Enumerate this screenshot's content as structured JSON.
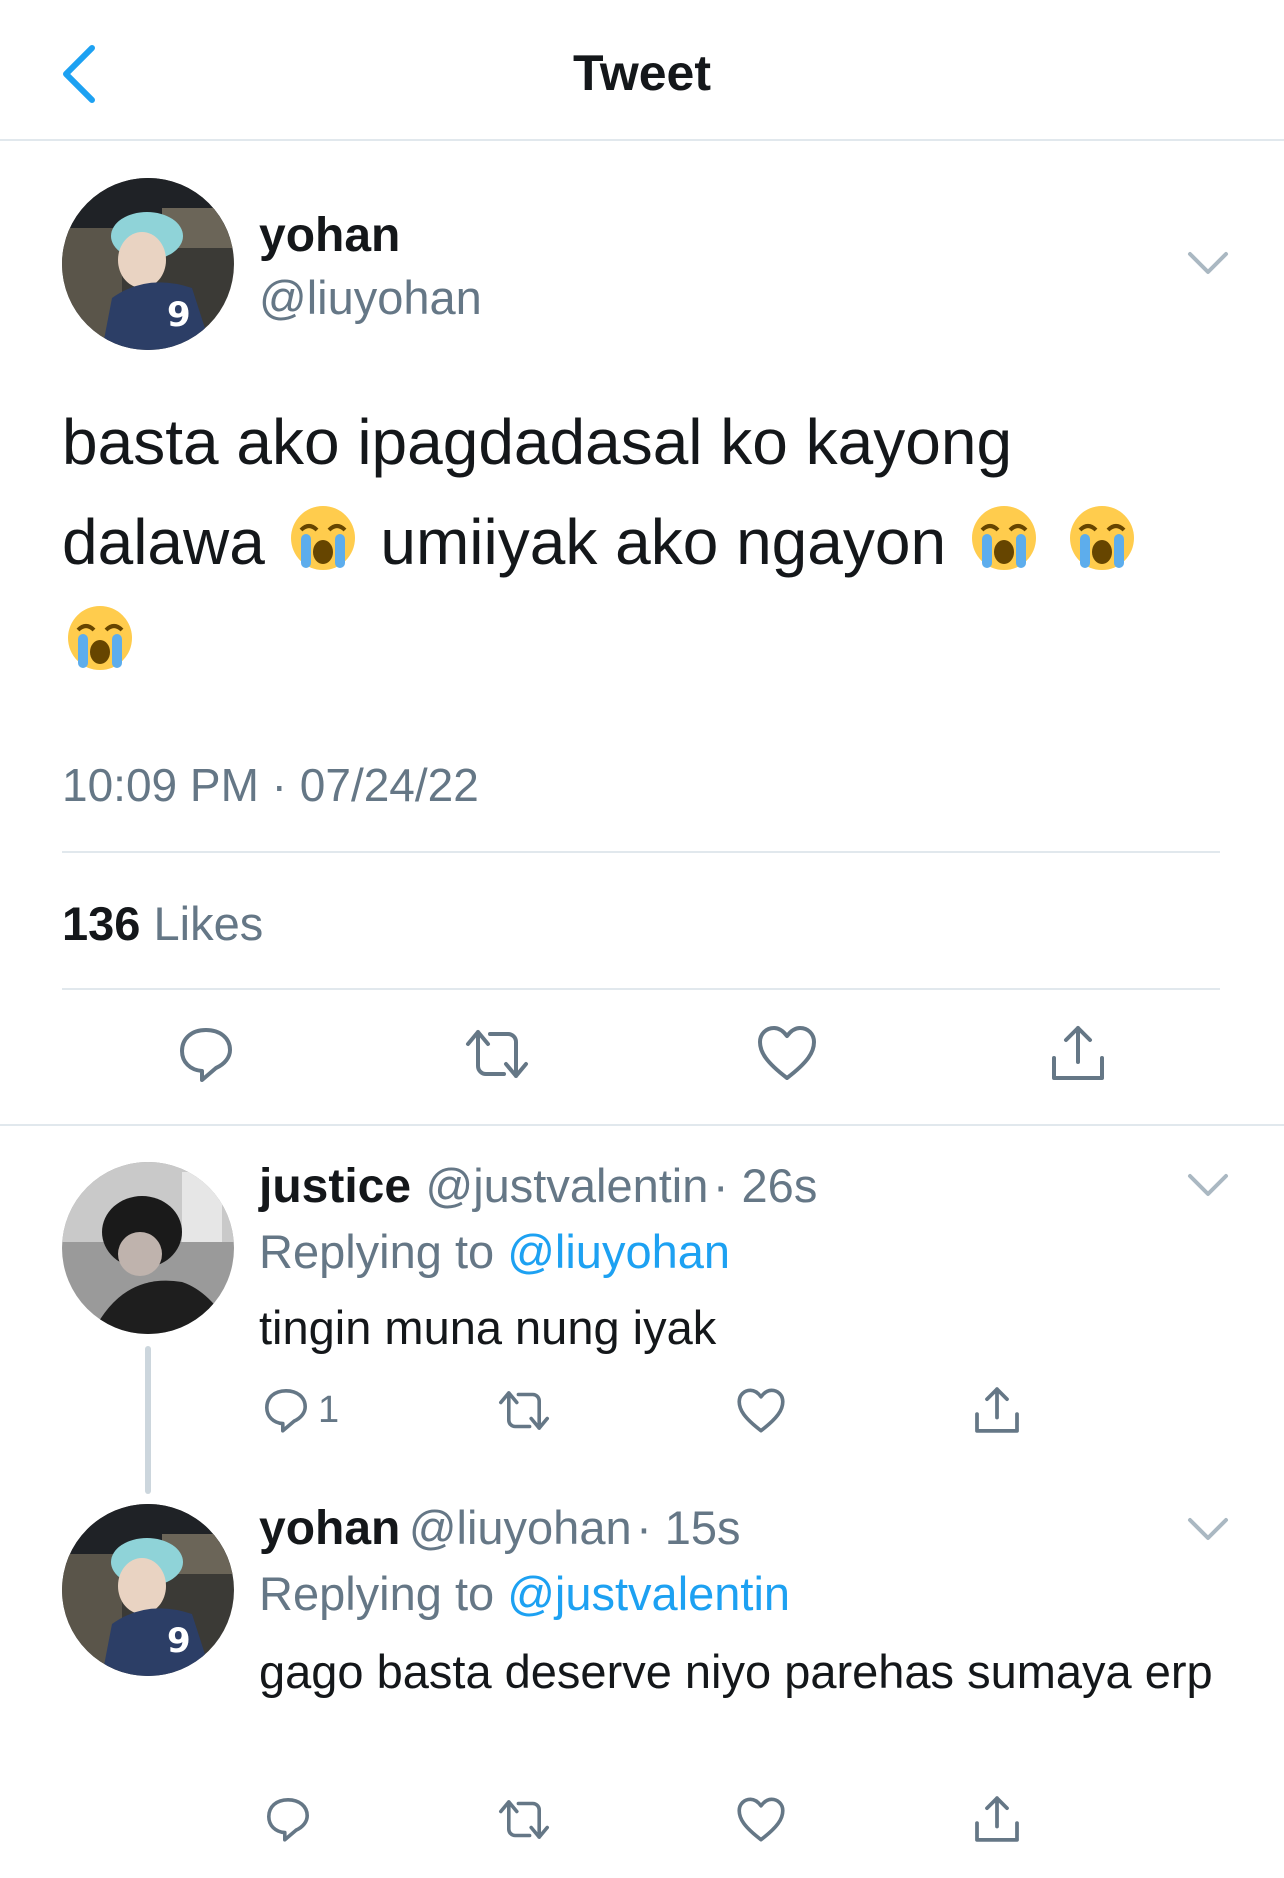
{
  "header": {
    "title": "Tweet"
  },
  "tweet": {
    "name": "yohan",
    "handle": "@liuyohan",
    "text_line1": "basta ako ipagdadasal ko kayong",
    "text_line2a": "dalawa",
    "text_line2b": "umiiyak ako ngayon",
    "emoji": "crying-face",
    "timestamp": "10:09 PM · 07/24/22",
    "likes_count": "136",
    "likes_label": "Likes"
  },
  "replies": [
    {
      "name": "justice",
      "handle": "@justvalentin",
      "time": "· 26s",
      "replying_label": "Replying to",
      "replying_to": "@liuyohan",
      "text": "tingin muna nung iyak",
      "reply_count": "1"
    },
    {
      "name": "yohan",
      "handle": "@liuyohan",
      "time": "· 15s",
      "replying_label": "Replying to",
      "replying_to": "@justvalentin",
      "text": "gago basta deserve niyo parehas sumaya erp"
    }
  ],
  "colors": {
    "accent": "#1da1f2",
    "muted": "#657786",
    "divider": "#e1e8ed"
  }
}
